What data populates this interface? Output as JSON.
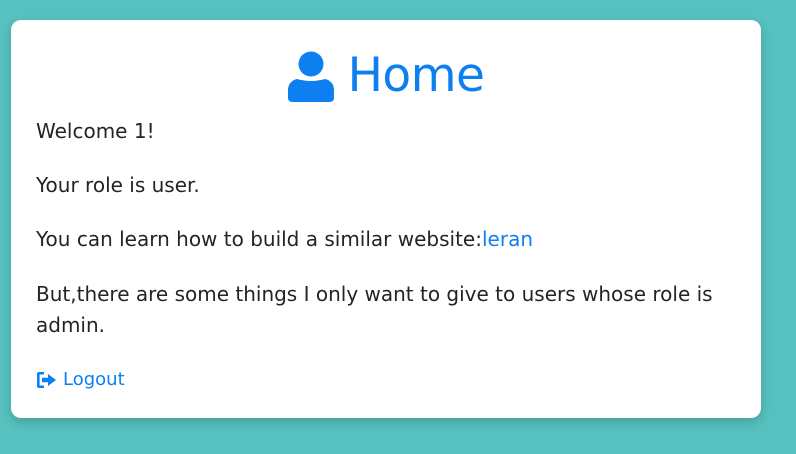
{
  "colors": {
    "background": "#56c1bf",
    "card": "#ffffff",
    "accent": "#0d7ff0",
    "text": "#212529"
  },
  "header": {
    "icon": "user-icon",
    "title": "Home"
  },
  "content": {
    "welcome": "Welcome 1!",
    "role": "Your role is user.",
    "learn_prefix": "You can learn how to build a similar website:",
    "learn_link": "leran",
    "admin_note": "But,there are some things I only want to give to users whose role is admin."
  },
  "logout": {
    "icon": "sign-out-icon",
    "label": "Logout"
  }
}
